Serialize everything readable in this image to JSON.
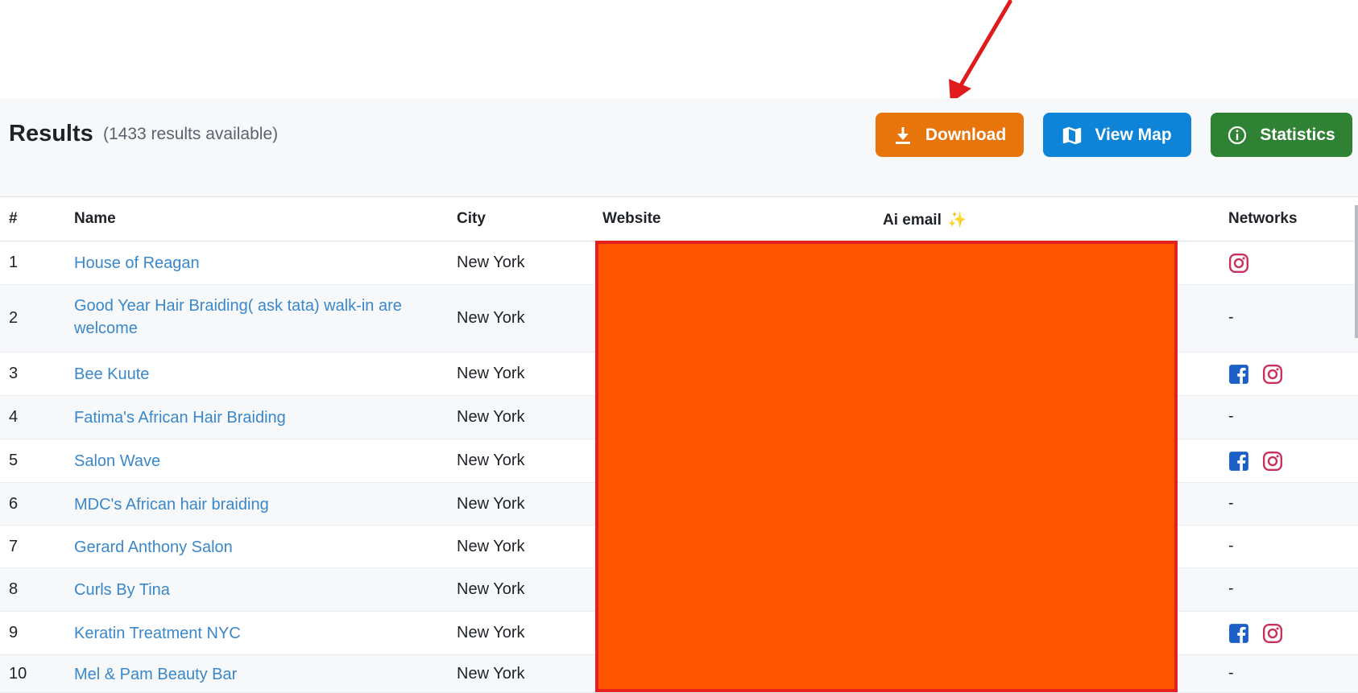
{
  "results": {
    "title": "Results",
    "count_text": "(1433 results available)"
  },
  "buttons": {
    "download": "Download",
    "view_map": "View Map",
    "statistics": "Statistics"
  },
  "columns": {
    "num": "#",
    "name": "Name",
    "city": "City",
    "website": "Website",
    "ai_email": "Ai email",
    "ai_email_icon": "✨",
    "networks": "Networks"
  },
  "rows": [
    {
      "num": "1",
      "name": "House of Reagan",
      "city": "New York",
      "networks": [
        "instagram-icon"
      ]
    },
    {
      "num": "2",
      "name": "Good Year Hair Braiding( ask tata) walk-in are welcome",
      "city": "New York",
      "networks": [],
      "empty": "-"
    },
    {
      "num": "3",
      "name": "Bee Kuute",
      "city": "New York",
      "networks": [
        "facebook-icon",
        "instagram-icon"
      ]
    },
    {
      "num": "4",
      "name": "Fatima's African Hair Braiding",
      "city": "New York",
      "networks": [],
      "empty": "-"
    },
    {
      "num": "5",
      "name": "Salon Wave",
      "city": "New York",
      "networks": [
        "facebook-icon",
        "instagram-icon"
      ]
    },
    {
      "num": "6",
      "name": "MDC's African hair braiding",
      "city": "New York",
      "networks": [],
      "empty": "-"
    },
    {
      "num": "7",
      "name": "Gerard Anthony Salon",
      "city": "New York",
      "networks": [],
      "empty": "-"
    },
    {
      "num": "8",
      "name": "Curls By Tina",
      "city": "New York",
      "networks": [],
      "empty": "-"
    },
    {
      "num": "9",
      "name": "Keratin Treatment NYC",
      "city": "New York",
      "networks": [
        "facebook-icon",
        "instagram-icon"
      ]
    },
    {
      "num": "10",
      "name": "Mel & Pam Beauty Bar",
      "city": "New York",
      "networks": [],
      "empty": "-"
    }
  ],
  "colors": {
    "download": "#e8740c",
    "view_map": "#0d84d8",
    "statistics": "#2f8133",
    "link": "#3a87c9",
    "redaction_fill": "#fd5500",
    "redaction_border": "#e5201f",
    "annotation_arrow": "#e01b1b"
  }
}
